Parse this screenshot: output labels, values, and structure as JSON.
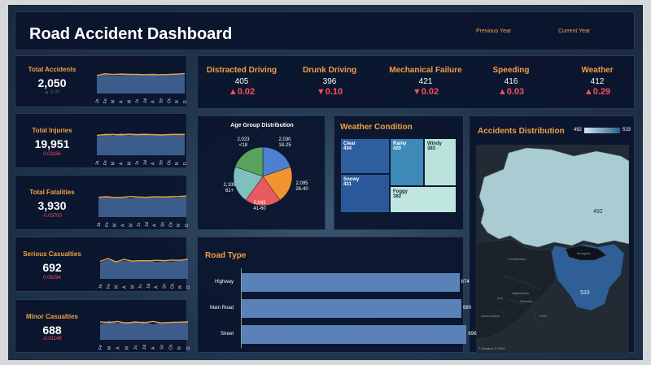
{
  "header": {
    "title": "Road Accident Dashboard",
    "previous_year_label": "Previous Year",
    "current_year_label": "Current Year"
  },
  "kpis": [
    {
      "title": "Total Accidents",
      "value": "2,050",
      "delta": "▲ 0.00"
    },
    {
      "title": "Total Injuries",
      "value": "19,951",
      "delta": "0.03186"
    },
    {
      "title": "Total Fatalities",
      "value": "3,930",
      "delta": "-0.03700"
    },
    {
      "title": "Serious Casualties",
      "value": "692",
      "delta": "0.08294"
    },
    {
      "title": "Minor Casualties",
      "value": "688",
      "delta": "-0.01149"
    }
  ],
  "causes": [
    {
      "title": "Distracted Driving",
      "value": "405",
      "delta": "▲0.02"
    },
    {
      "title": "Drunk Driving",
      "value": "396",
      "delta": "▼0.10"
    },
    {
      "title": "Mechanical Failure",
      "value": "421",
      "delta": "▼0.02"
    },
    {
      "title": "Speeding",
      "value": "416",
      "delta": "▲0.03"
    },
    {
      "title": "Weather",
      "value": "412",
      "delta": "▲0.29"
    }
  ],
  "age_group": {
    "title": "Age Group Distribution",
    "labels": [
      {
        "value": "2,030",
        "group": "18-25"
      },
      {
        "value": "2,095",
        "group": "26-40"
      },
      {
        "value": "2,043",
        "group": "41-60"
      },
      {
        "value": "2,105",
        "group": "61+"
      },
      {
        "value": "2,023",
        "group": "<18"
      }
    ]
  },
  "weather_condition": {
    "title": "Weather Condition",
    "cells": [
      {
        "name": "Clear",
        "value": "434"
      },
      {
        "name": "Rainy",
        "value": "420"
      },
      {
        "name": "Windy",
        "value": "383"
      },
      {
        "name": "Snowy",
        "value": "431"
      },
      {
        "name": "Foggy",
        "value": "382"
      }
    ]
  },
  "accidents_distribution": {
    "title": "Accidents Distribution",
    "legend_min": "492",
    "legend_max": "533",
    "region_north_value": "492",
    "region_south_value": "533",
    "place_labels": [
      "Kazakhstan",
      "Mongolia",
      "Afghanistan",
      "Pakistan",
      "Iran",
      "Saudi Arabia",
      "India"
    ],
    "credit": "© Mapbox © OSM"
  },
  "road_type": {
    "title": "Road Type",
    "rows": [
      {
        "name": "Highway",
        "value": "674"
      },
      {
        "name": "Main Road",
        "value": "680"
      },
      {
        "name": "Street",
        "value": "696"
      }
    ]
  },
  "chart_data": [
    {
      "type": "area",
      "title": "Total Accidents",
      "categories": [
        "Ja",
        "Fe",
        "M",
        "A",
        "M",
        "Ju",
        "Jul",
        "A",
        "Se",
        "Oc",
        "N",
        "D"
      ],
      "series": [
        {
          "name": "Previous Year",
          "values": [
            150,
            175,
            160,
            165,
            170,
            180,
            175,
            185,
            170,
            172,
            175,
            183
          ]
        },
        {
          "name": "Current Year",
          "values": [
            160,
            180,
            172,
            176,
            174,
            172,
            170,
            168,
            170,
            172,
            176,
            182
          ]
        }
      ],
      "ylim": [
        0,
        200
      ]
    },
    {
      "type": "area",
      "title": "Total Injuries",
      "categories": [
        "Ja",
        "Fe",
        "M",
        "A",
        "M",
        "Ju",
        "Jul",
        "A",
        "Se",
        "Oc",
        "N",
        "D"
      ],
      "series": [
        {
          "name": "Previous Year",
          "values": [
            1500,
            1780,
            1560,
            1850,
            1620,
            1750,
            1800,
            1700,
            1720,
            1650,
            1740,
            1760
          ]
        },
        {
          "name": "Current Year",
          "values": [
            1620,
            1690,
            1700,
            1660,
            1730,
            1680,
            1700,
            1690,
            1650,
            1690,
            1710,
            1700
          ]
        }
      ],
      "ylim": [
        0,
        2000
      ]
    },
    {
      "type": "area",
      "title": "Total Fatalities",
      "categories": [
        "Ja",
        "Fe",
        "M",
        "A",
        "M",
        "Ju",
        "Jul",
        "A",
        "Se",
        "Oc",
        "N",
        "D"
      ],
      "series": [
        {
          "name": "Previous Year",
          "values": [
            300,
            340,
            310,
            330,
            300,
            320,
            330,
            310,
            340,
            320,
            310,
            350
          ]
        },
        {
          "name": "Current Year",
          "values": [
            320,
            330,
            315,
            320,
            335,
            325,
            320,
            330,
            325,
            330,
            335,
            345
          ]
        }
      ],
      "ylim": [
        0,
        400
      ]
    },
    {
      "type": "area",
      "title": "Serious Casualties",
      "categories": [
        "Ja",
        "Fe",
        "M",
        "A",
        "M",
        "Ju",
        "Jul",
        "A",
        "Se",
        "Oc",
        "N",
        "D"
      ],
      "series": [
        {
          "name": "Previous Year",
          "values": [
            50,
            62,
            52,
            58,
            55,
            57,
            60,
            53,
            56,
            54,
            58,
            62
          ]
        },
        {
          "name": "Current Year",
          "values": [
            55,
            66,
            53,
            63,
            56,
            58,
            57,
            59,
            58,
            60,
            59,
            63
          ]
        }
      ],
      "ylim": [
        0,
        80
      ]
    },
    {
      "type": "area",
      "title": "Minor Casualties",
      "categories": [
        "Fe",
        "M",
        "A",
        "M",
        "Ju",
        "Jul",
        "A",
        "Se",
        "Oc",
        "N",
        "D"
      ],
      "series": [
        {
          "name": "Previous Year",
          "values": [
            50,
            65,
            55,
            60,
            58,
            62,
            50,
            58,
            56,
            60,
            64
          ]
        },
        {
          "name": "Current Year",
          "values": [
            60,
            58,
            62,
            55,
            60,
            57,
            62,
            56,
            58,
            59,
            60
          ]
        }
      ],
      "ylim": [
        0,
        80
      ]
    },
    {
      "type": "pie",
      "title": "Age Group Distribution",
      "categories": [
        "18-25",
        "26-40",
        "41-60",
        "61+",
        "<18"
      ],
      "values": [
        2030,
        2095,
        2043,
        2105,
        2023
      ],
      "colors": [
        "#4f7fd0",
        "#f39330",
        "#e85a5f",
        "#7ec0bb",
        "#5aa35a"
      ]
    },
    {
      "type": "heatmap",
      "title": "Weather Condition",
      "categories": [
        "Clear",
        "Rainy",
        "Windy",
        "Snowy",
        "Foggy"
      ],
      "values": [
        434,
        420,
        383,
        431,
        382
      ]
    },
    {
      "type": "bar",
      "title": "Road Type",
      "categories": [
        "Highway",
        "Main Road",
        "Street"
      ],
      "values": [
        674,
        680,
        696
      ]
    }
  ],
  "colors": {
    "accent": "#f0a040",
    "negative": "#ff4d5e",
    "area_fill": "#3c5c8c",
    "line_current": "#f0a040"
  }
}
